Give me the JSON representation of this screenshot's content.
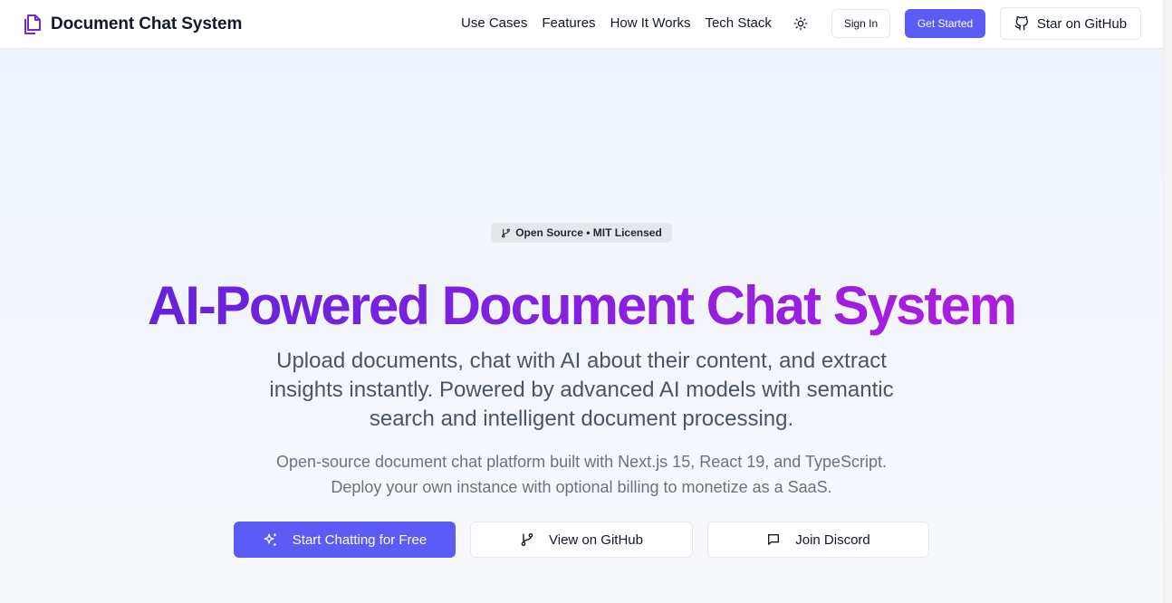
{
  "header": {
    "brand_title": "Document Chat System",
    "nav": [
      "Use Cases",
      "Features",
      "How It Works",
      "Tech Stack"
    ],
    "sign_in_label": "Sign In",
    "get_started_label": "Get Started",
    "star_label": "Star on GitHub"
  },
  "hero": {
    "badge": "Open Source • MIT Licensed",
    "headline": "AI-Powered Document Chat System",
    "subtitle": "Upload documents, chat with AI about their content, and extract insights instantly. Powered by advanced AI models with semantic search and intelligent document processing.",
    "subnote": "Open-source document chat platform built with Next.js 15, React 19, and TypeScript. Deploy your own instance with optional billing to monetize as a SaaS.",
    "cta_primary": "Start Chatting for Free",
    "cta_github": "View on GitHub",
    "cta_discord": "Join Discord"
  },
  "icons": {
    "brand": "document-stack-icon",
    "theme": "sun-icon",
    "star": "github-icon",
    "badge": "git-fork-icon",
    "cta_primary": "sparkles-icon",
    "cta_github": "git-fork-icon",
    "cta_discord": "message-square-icon"
  },
  "colors": {
    "accent": "#5b5bf6",
    "brand_purple": "#6d28d9",
    "headline_start": "#5b21d8",
    "headline_end": "#b81fd6"
  }
}
